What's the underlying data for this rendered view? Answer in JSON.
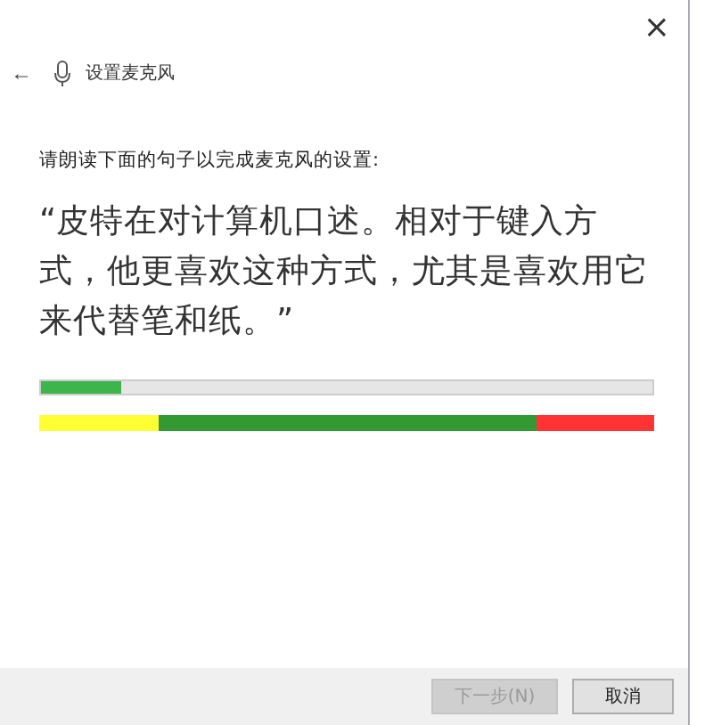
{
  "window": {
    "close": "×"
  },
  "header": {
    "back": "←",
    "title": "设置麦克风"
  },
  "instruction": "请朗读下面的句子以完成麦克风的设置:",
  "sentence": "“皮特在对计算机口述。相对于键入方式，他更喜欢这种方式，尤其是喜欢用它来代替笔和纸。”",
  "meter": {
    "level": 0.13
  },
  "buttons": [
    {
      "label": "下一步(N)",
      "disabled": true
    },
    {
      "label": "取消",
      "disabled": false
    }
  ]
}
